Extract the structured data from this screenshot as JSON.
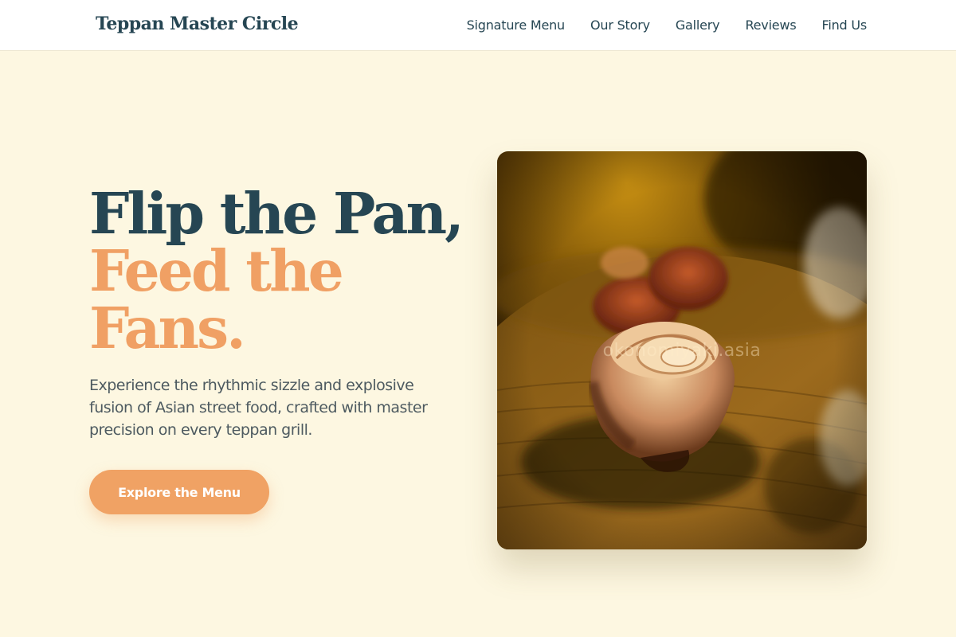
{
  "brand": "Teppan Master Circle",
  "nav": [
    {
      "label": "Signature Menu"
    },
    {
      "label": "Our Story"
    },
    {
      "label": "Gallery"
    },
    {
      "label": "Reviews"
    },
    {
      "label": "Find Us"
    }
  ],
  "hero": {
    "title_line1": "Flip the Pan,",
    "title_line2": "Feed the",
    "title_line3": "Fans.",
    "description": "Experience the rhythmic sizzle and explosive fusion of Asian street food, crafted with master precision on every teppan grill.",
    "cta_label": "Explore the Menu",
    "image_watermark": "okonomiyaki.asia"
  },
  "colors": {
    "background": "#fdf7e1",
    "primary_dark": "#264653",
    "accent": "#f0a264",
    "body_text": "#4d5a60"
  }
}
